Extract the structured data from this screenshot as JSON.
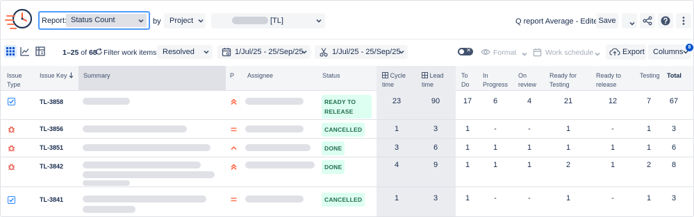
{
  "header": {
    "report_label": "Report:",
    "report_value": "Status Count",
    "by_label": "by",
    "group_by_value": "Project",
    "project_value": "[TL]",
    "report_title": "Q report Average - Edited",
    "save_label": "Save"
  },
  "toolbar": {
    "range_prefix": "1–25",
    "of_label": "of",
    "total_count": "68",
    "filter_label": "Filter work items:",
    "filter_value": "Resolved",
    "date_range_1": "1/Jul/25 - 25/Sep/25",
    "date_range_2": "1/Jul/25 - 25/Sep/25",
    "format_label": "Format",
    "schedule_label": "Work schedule",
    "export_label": "Export",
    "columns_label": "Columns",
    "columns_badge": "8"
  },
  "columns": {
    "issue_type": [
      "Issue",
      "Type"
    ],
    "issue_key": "Issue Key",
    "summary": "Summary",
    "priority": "P",
    "assignee": "Assignee",
    "status": "Status",
    "cycle_time": [
      "Cycle",
      "time"
    ],
    "lead_time": [
      "Lead",
      "time"
    ],
    "to_do": [
      "To",
      "Do"
    ],
    "in_progress": [
      "In",
      "Progress"
    ],
    "on_review": [
      "On",
      "review"
    ],
    "ready_for_testing": [
      "Ready for",
      "Testing"
    ],
    "ready_to_release": [
      "Ready to",
      "release"
    ],
    "testing": "Testing",
    "total": "Total"
  },
  "rows": [
    {
      "type": "task",
      "key": "TL-3858",
      "priority": "high",
      "status": [
        "READY TO",
        "RELEASE"
      ],
      "cycle": "23",
      "lead": "90",
      "todo": "17",
      "inprog": "6",
      "review": "4",
      "rft": "21",
      "rtr": "12",
      "testing": "7",
      "total": "67"
    },
    {
      "type": "bug",
      "key": "TL-3856",
      "priority": "medium",
      "status": [
        "CANCELLED"
      ],
      "cycle": "1",
      "lead": "3",
      "todo": "1",
      "inprog": "-",
      "review": "-",
      "rft": "1",
      "rtr": "-",
      "testing": "1",
      "total": "3"
    },
    {
      "type": "bug",
      "key": "TL-3851",
      "priority": "low-up",
      "status": [
        "DONE"
      ],
      "cycle": "3",
      "lead": "6",
      "todo": "1",
      "inprog": "1",
      "review": "1",
      "rft": "1",
      "rtr": "1",
      "testing": "1",
      "total": "6"
    },
    {
      "type": "bug",
      "key": "TL-3842",
      "priority": "high",
      "status": [
        "DONE"
      ],
      "cycle": "4",
      "lead": "9",
      "todo": "1",
      "inprog": "1",
      "review": "1",
      "rft": "2",
      "rtr": "1",
      "testing": "2",
      "total": "8"
    },
    {
      "type": "task",
      "key": "TL-3841",
      "priority": "medium",
      "status": [
        "CANCELLED"
      ],
      "cycle": "1",
      "lead": "3",
      "todo": "1",
      "inprog": "-",
      "review": "-",
      "rft": "1",
      "rtr": "-",
      "testing": "1",
      "total": "3"
    }
  ],
  "colors": {
    "accent_blue": "#0052cc",
    "focus_blue": "#4c9aff",
    "status_green_text": "#216e4e",
    "status_green_bg": "#dcfff1",
    "bug_red": "#e5493a",
    "priority_orange": "#ff7452",
    "task_blue": "#2684ff"
  },
  "icons": {
    "logo": "clock-speed-logo-icon",
    "share": "share-icon",
    "help": "help-icon",
    "more": "more-vertical-icon",
    "grid_view": "grid-view-icon",
    "chart_view": "line-chart-icon",
    "pivot_view": "pivot-table-icon",
    "refresh": "refresh-icon",
    "calendar": "calendar-icon",
    "resolution_date": "scissors-icon",
    "format": "eye-icon",
    "schedule": "calendar-icon",
    "export": "cloud-upload-icon"
  }
}
